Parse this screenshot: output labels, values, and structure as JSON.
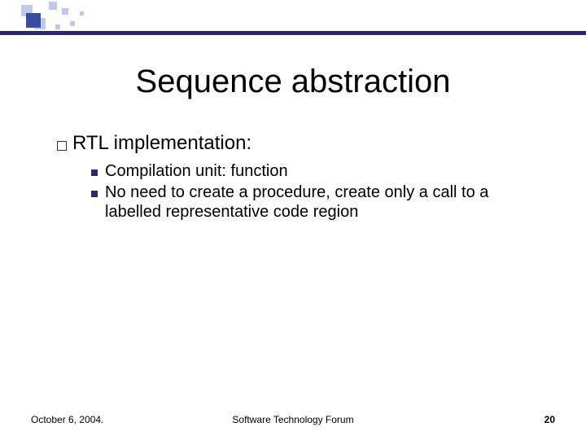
{
  "title": "Sequence abstraction",
  "bullet1": {
    "text": "RTL implementation:"
  },
  "sub1": {
    "text": "Compilation unit: function"
  },
  "sub2": {
    "text": "No need to create a procedure, create only a call to a labelled representative code region"
  },
  "footer": {
    "date": "October 6, 2004.",
    "center": "Software Technology Forum",
    "page": "20"
  }
}
